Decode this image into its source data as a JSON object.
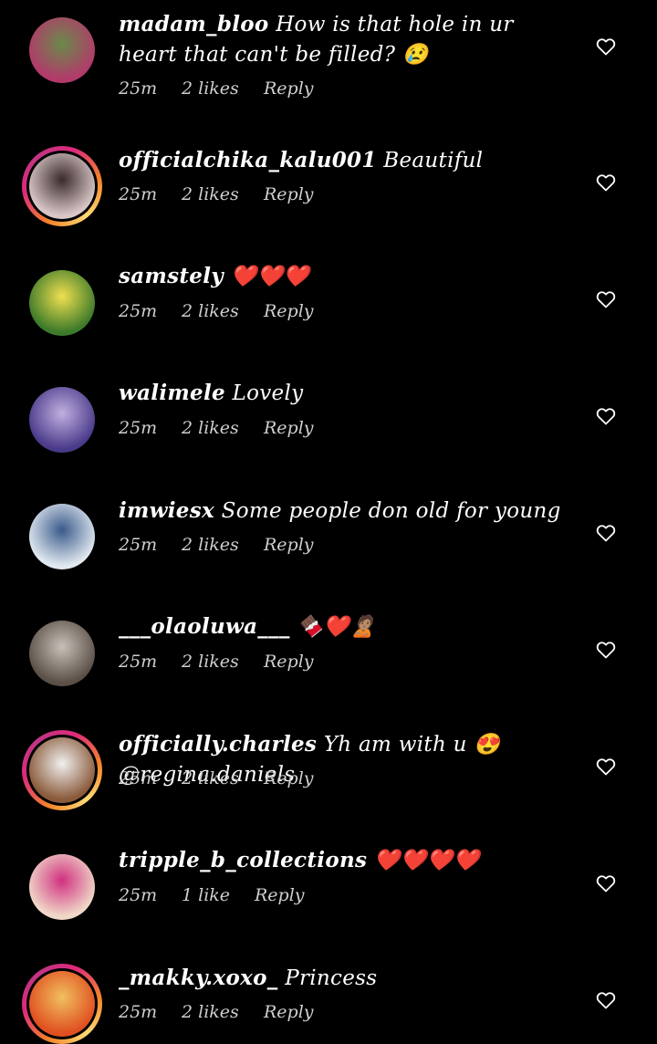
{
  "comments": [
    {
      "username": "madam_bloo",
      "text": "How is that hole in ur heart that can't be filled? 😢",
      "time": "25m",
      "likes": "2 likes",
      "reply": "Reply",
      "has_story_ring": false,
      "avatar_colors": [
        "#b23a6b",
        "#6a8a4a"
      ]
    },
    {
      "username": "officialchika_kalu001",
      "text": "Beautiful",
      "time": "25m",
      "likes": "2 likes",
      "reply": "Reply",
      "has_story_ring": true,
      "avatar_colors": [
        "#d9c7c7",
        "#3a2a2a"
      ]
    },
    {
      "username": "samstely",
      "text": "❤️❤️❤️",
      "time": "25m",
      "likes": "2 likes",
      "reply": "Reply",
      "has_story_ring": false,
      "avatar_colors": [
        "#3d7a2a",
        "#f0e050"
      ]
    },
    {
      "username": "walimele",
      "text": "Lovely",
      "time": "25m",
      "likes": "2 likes",
      "reply": "Reply",
      "has_story_ring": false,
      "avatar_colors": [
        "#4a3a8a",
        "#c0b0e0"
      ]
    },
    {
      "username": "imwiesx",
      "text": "Some people don old for young",
      "time": "25m",
      "likes": "2 likes",
      "reply": "Reply",
      "has_story_ring": false,
      "avatar_colors": [
        "#e0e8f0",
        "#3a5a8a"
      ]
    },
    {
      "username": "___olaoluwa___",
      "text": "🍫❤️🙎🏽",
      "time": "25m",
      "likes": "2 likes",
      "reply": "Reply",
      "has_story_ring": false,
      "avatar_colors": [
        "#5a5048",
        "#c8c0b8"
      ]
    },
    {
      "username": "officially.charles",
      "text": "Yh am with u 😍@regina.daniels",
      "time": "25m",
      "likes": "2 likes",
      "reply": "Reply",
      "has_story_ring": true,
      "avatar_colors": [
        "#8a5a3a",
        "#f0f0f0"
      ]
    },
    {
      "username": "tripple_b_collections",
      "text": "❤️❤️❤️❤️",
      "time": "25m",
      "likes": "1 like",
      "reply": "Reply",
      "has_story_ring": false,
      "avatar_colors": [
        "#f0d8c8",
        "#d03080"
      ]
    },
    {
      "username": "_makky.xoxo_",
      "text": "Princess",
      "time": "25m",
      "likes": "2 likes",
      "reply": "Reply",
      "has_story_ring": true,
      "avatar_colors": [
        "#e05020",
        "#f0c060"
      ]
    }
  ],
  "icons": {
    "like": "heart-outline-icon"
  }
}
